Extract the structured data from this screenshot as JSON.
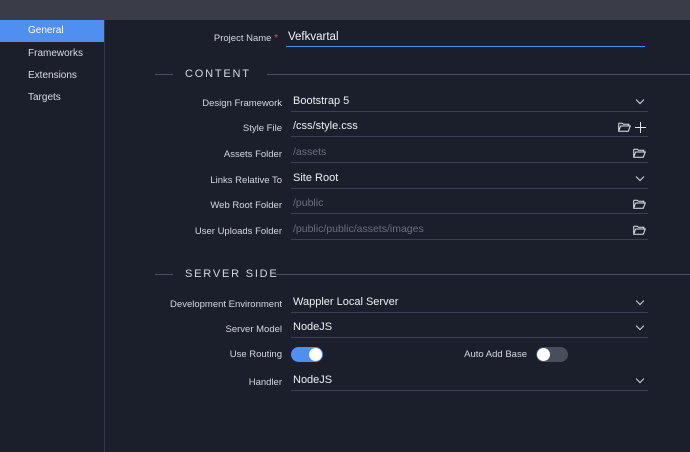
{
  "sidebar": {
    "items": [
      {
        "label": "General",
        "active": true
      },
      {
        "label": "Frameworks",
        "active": false
      },
      {
        "label": "Extensions",
        "active": false
      },
      {
        "label": "Targets",
        "active": false
      }
    ]
  },
  "project": {
    "label": "Project Name",
    "required_mark": "*",
    "value": "Vefkvartal"
  },
  "content_section": {
    "title": "CONTENT",
    "design_framework": {
      "label": "Design Framework",
      "value": "Bootstrap 5"
    },
    "style_file": {
      "label": "Style File",
      "value": "/css/style.css"
    },
    "assets_folder": {
      "label": "Assets Folder",
      "placeholder": "/assets"
    },
    "links_relative_to": {
      "label": "Links Relative To",
      "value": "Site Root"
    },
    "web_root_folder": {
      "label": "Web Root Folder",
      "placeholder": "/public"
    },
    "user_uploads_folder": {
      "label": "User Uploads Folder",
      "placeholder": "/public/public/assets/images"
    }
  },
  "server_section": {
    "title": "SERVER SIDE",
    "dev_environment": {
      "label": "Development Environment",
      "value": "Wappler Local Server"
    },
    "server_model": {
      "label": "Server Model",
      "value": "NodeJS"
    },
    "use_routing": {
      "label": "Use Routing",
      "on": true
    },
    "auto_add_base": {
      "label": "Auto Add Base",
      "on": false
    },
    "handler": {
      "label": "Handler",
      "value": "NodeJS"
    }
  },
  "colors": {
    "accent": "#4f8ff0",
    "background": "#1b1e2b",
    "titlebar": "#3a3c47",
    "required": "#e0504f"
  },
  "icons": [
    "folder-open-icon",
    "plus-icon",
    "chevron-down-icon"
  ]
}
